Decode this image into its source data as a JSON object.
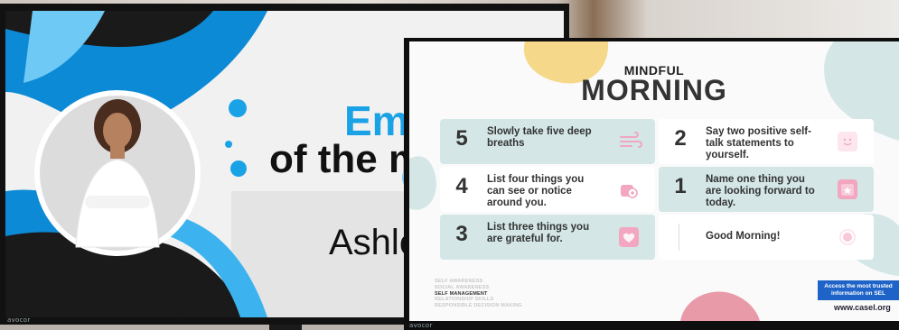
{
  "slide1": {
    "title_line1": "Em",
    "title_line2": "of the m",
    "name": "Ashle",
    "brand": "avocor"
  },
  "slide2": {
    "kicker": "MINDFUL",
    "title": "MORNING",
    "cards": [
      {
        "number": "5",
        "text": "Slowly take five deep breaths",
        "icon": "wind-icon"
      },
      {
        "number": "2",
        "text": "Say two positive self-talk statements to yourself.",
        "icon": "smile-icon"
      },
      {
        "number": "4",
        "text": "List four things you can see or notice around you.",
        "icon": "eye-icon"
      },
      {
        "number": "1",
        "text": "Name one thing you are looking forward to today.",
        "icon": "calendar-star-icon"
      },
      {
        "number": "3",
        "text": "List three things you are grateful for.",
        "icon": "heart-icon"
      },
      {
        "number": "",
        "text": "Good Morning!",
        "icon": "sun-icon"
      }
    ],
    "sel_competencies": [
      "SELF AWARENESS",
      "SOCIAL AWARENESS",
      "SELF MANAGEMENT",
      "RELATIONSHIP SKILLS",
      "RESPONSIBLE DECISION MAKING"
    ],
    "sel_active": "SELF MANAGEMENT",
    "cta": "Access the most trusted information on SEL",
    "url": "www.casel.org",
    "brand": "avocor"
  },
  "colors": {
    "accent_blue": "#1aa2e6",
    "card_teal": "#d4e6e6",
    "icon_pink": "#f2a6c0",
    "cta_blue": "#1e63c8"
  }
}
